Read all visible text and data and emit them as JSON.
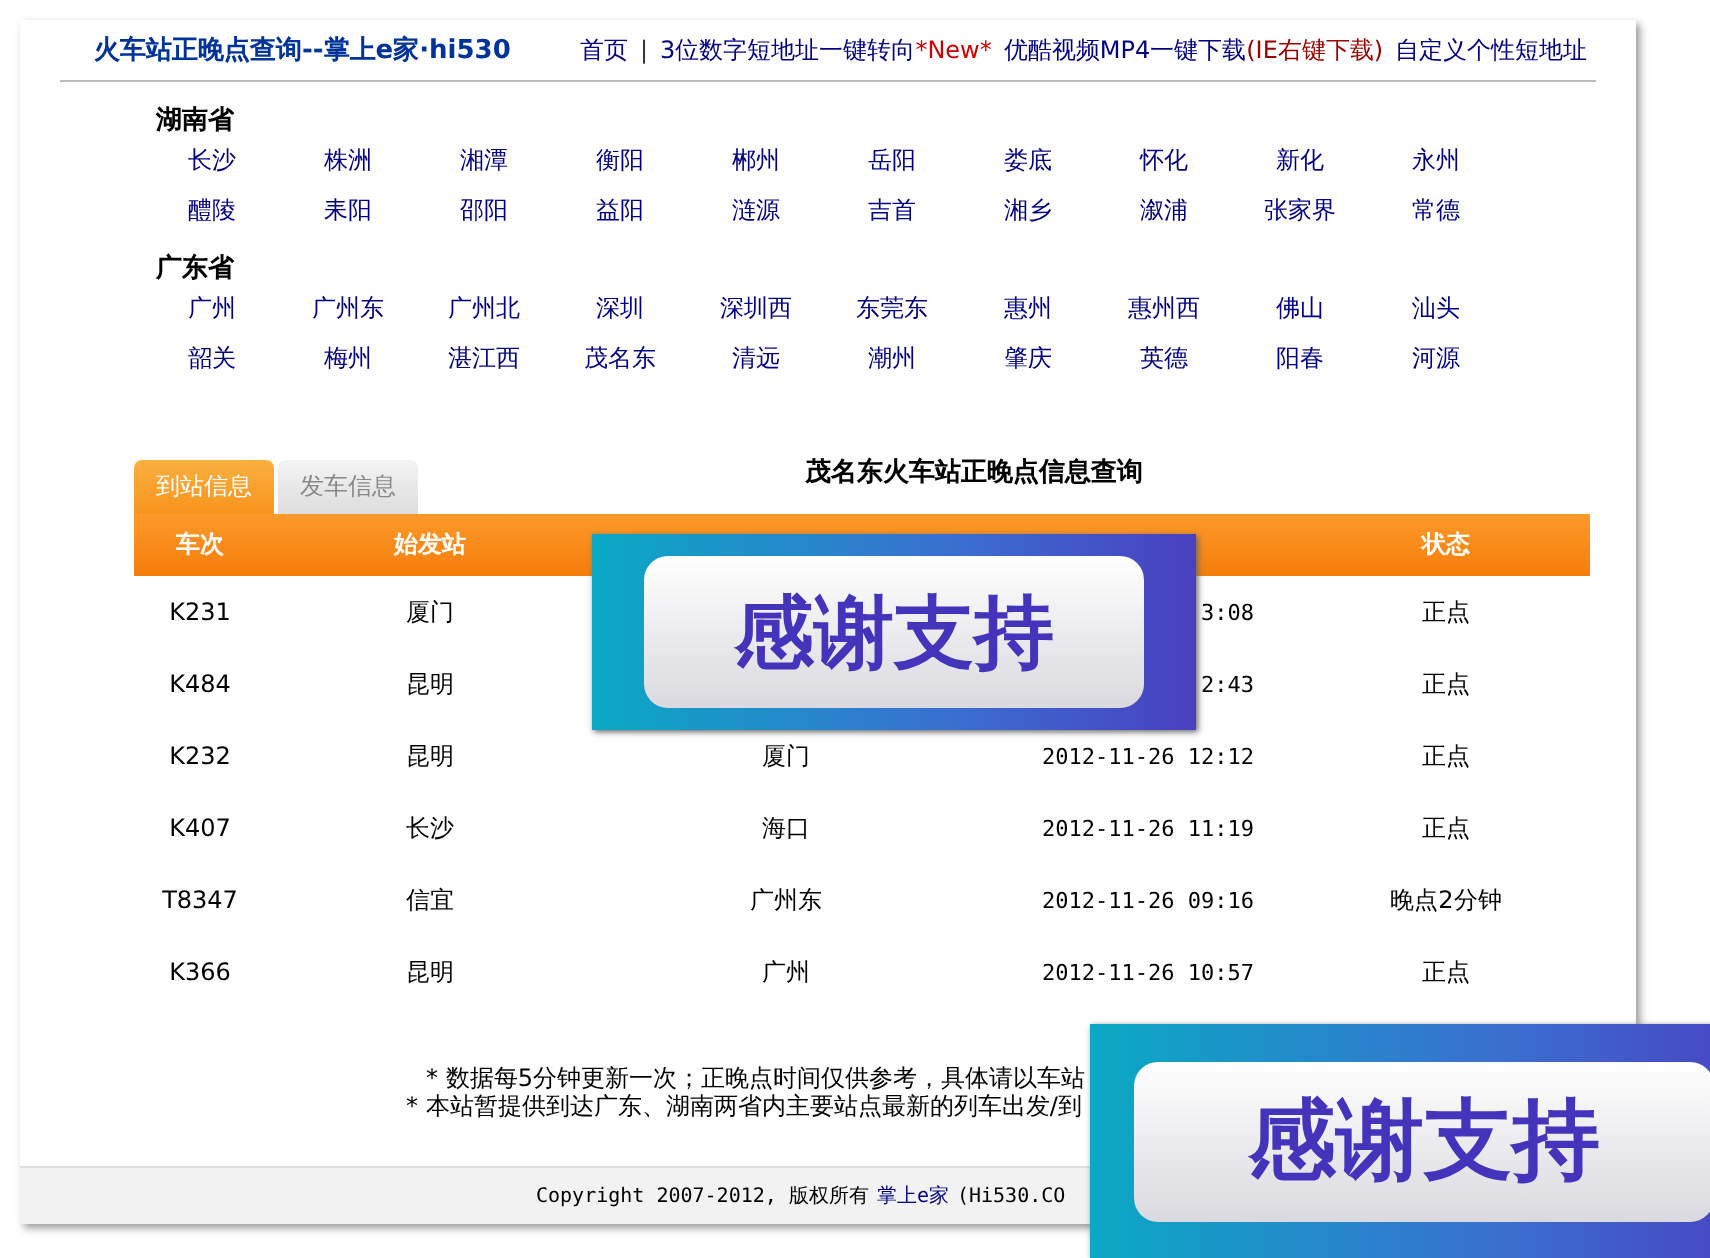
{
  "header": {
    "title": "火车站正晚点查询--掌上e家·hi530",
    "nav": [
      {
        "text": "首页"
      },
      {
        "text": "3位数字短地址一键转向",
        "tag": "*New*"
      },
      {
        "text": "优酷视频MP4一键下载",
        "tag": "(IE右键下载)"
      },
      {
        "text": "自定义个性短地址"
      }
    ],
    "separator": "|"
  },
  "provinces": [
    {
      "name": "湖南省",
      "cities": [
        "长沙",
        "株洲",
        "湘潭",
        "衡阳",
        "郴州",
        "岳阳",
        "娄底",
        "怀化",
        "新化",
        "永州",
        "醴陵",
        "耒阳",
        "邵阳",
        "益阳",
        "涟源",
        "吉首",
        "湘乡",
        "溆浦",
        "张家界",
        "常德"
      ]
    },
    {
      "name": "广东省",
      "cities": [
        "广州",
        "广州东",
        "广州北",
        "深圳",
        "深圳西",
        "东莞东",
        "惠州",
        "惠州西",
        "佛山",
        "汕头",
        "韶关",
        "梅州",
        "湛江西",
        "茂名东",
        "清远",
        "潮州",
        "肇庆",
        "英德",
        "阳春",
        "河源"
      ]
    }
  ],
  "tabs": [
    {
      "label": "到站信息",
      "selected": true
    },
    {
      "label": "发车信息",
      "selected": false
    }
  ],
  "table": {
    "title": "茂名东火车站正晚点信息查询",
    "columns": [
      "车次",
      "始发站",
      "",
      "",
      "状态"
    ],
    "rows": [
      [
        "K231",
        "厦门",
        "",
        "3:08",
        "正点"
      ],
      [
        "K484",
        "昆明",
        "",
        "2:43",
        "正点"
      ],
      [
        "K232",
        "昆明",
        "厦门",
        "2012-11-26 12:12",
        "正点"
      ],
      [
        "K407",
        "长沙",
        "海口",
        "2012-11-26 11:19",
        "正点"
      ],
      [
        "T8347",
        "信宜",
        "广州东",
        "2012-11-26 09:16",
        "晚点2分钟"
      ],
      [
        "K366",
        "昆明",
        "广州",
        "2012-11-26 10:57",
        "正点"
      ]
    ]
  },
  "notes": [
    "* 数据每5分钟更新一次；正晚点时间仅供参考，具体请以车站",
    "* 本站暂提供到达广东、湖南两省内主要站点最新的列车出发/到"
  ],
  "footer": {
    "text": "Copyright 2007-2012, 版权所有",
    "link": "掌上e家",
    "rest": "(Hi530.CO"
  },
  "overlays": [
    "感谢支持",
    "感谢支持"
  ]
}
